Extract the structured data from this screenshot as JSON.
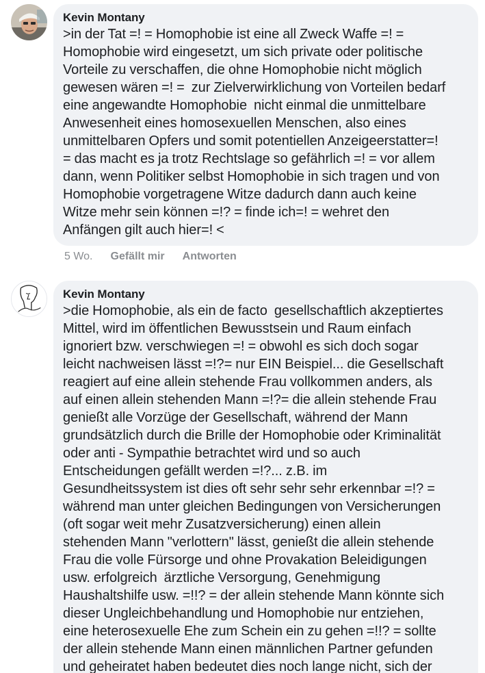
{
  "comments": [
    {
      "author": "Kevin Montany",
      "lines": [
        ">in der Tat =! = Homophobie ist eine all Zweck Waffe =! =",
        "Homophobie wird eingesetzt, um sich private oder politische",
        "Vorteile zu verschaffen, die ohne Homophobie nicht möglich",
        "gewesen wären =! =  zur Zielverwirklichung von Vorteilen bedarf",
        "eine angewandte Homophobie  nicht einmal die unmittelbare",
        "Anwesenheit eines homosexuellen Menschen, also eines",
        "unmittelbaren Opfers und somit potentiellen Anzeigeerstatter=!",
        "= das macht es ja trotz Rechtslage so gefährlich =! = vor allem",
        "dann, wenn Politiker selbst Homophobie in sich tragen und von",
        "Homophobie vorgetragene Witze dadurch dann auch keine",
        "Witze mehr sein können =!? = finde ich=! = wehret den",
        "Anfängen gilt auch hier=! <"
      ],
      "time": "5 Wo.",
      "like_label": "Gefällt mir",
      "reply_label": "Antworten"
    },
    {
      "author": "Kevin Montany",
      "lines": [
        ">die Homophobie, als ein de facto  gesellschaftlich akzeptiertes",
        "Mittel, wird im öffentlichen Bewusstsein und Raum einfach",
        "ignoriert bzw. verschwiegen =! = obwohl es sich doch sogar",
        "leicht nachweisen lässt =!?= nur EIN Beispiel... die Gesellschaft",
        "reagiert auf eine allein stehende Frau vollkommen anders, als",
        "auf einen allein stehenden Mann =!?= die allein stehende Frau",
        "genießt alle Vorzüge der Gesellschaft, während der Mann",
        "grundsätzlich durch die Brille der Homophobie oder Kriminalität",
        "oder anti - Sympathie betrachtet wird und so auch",
        "Entscheidungen gefällt werden =!?... z.B. im",
        "Gesundheitssystem ist dies oft sehr sehr sehr erkennbar =!? =",
        "während man unter gleichen Bedingungen von Versicherungen",
        "(oft sogar weit mehr Zusatzversicherung) einen allein",
        "stehenden Mann \"verlottern\" lässt, genießt die allein stehende",
        "Frau die volle Fürsorge und ohne Provakation Beleidigungen",
        "usw. erfolgreich  ärztliche Versorgung, Genehmigung",
        "Haushaltshilfe usw. =!!? = der allein stehende Mann könnte sich",
        "dieser Ungleichbehandlung und Homophobie nur entziehen,",
        "eine heterosexuelle Ehe zum Schein ein zu gehen =!!? = sollte",
        "der allein stehende Mann einen männlichen Partner gefunden",
        "und geheiratet haben bedeutet dies noch lange nicht, sich der"
      ]
    }
  ]
}
